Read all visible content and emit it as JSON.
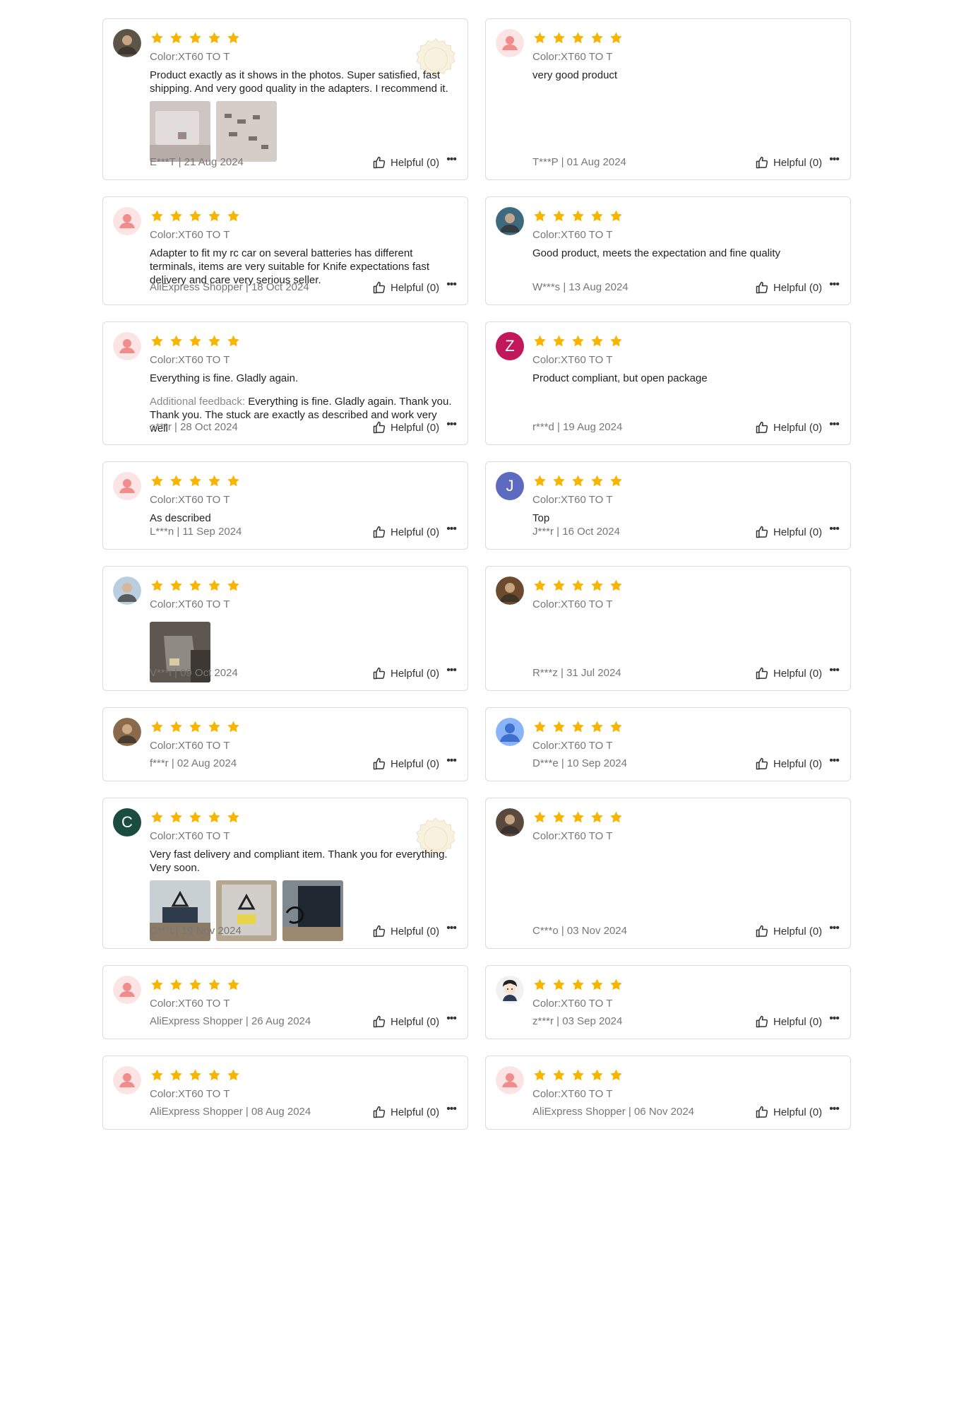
{
  "reviews": [
    {
      "avatar": "photo-avatar",
      "bg": "#5c5447",
      "variant": "Color:XT60 TO T",
      "text": "Product exactly as it shows in the photos. Super satisfied, fast shipping. And very good quality in the adapters. I recommend it.",
      "photos": [
        "photo-1",
        "photo-2"
      ],
      "selected": true,
      "author": "E***T | 21 Aug 2024",
      "helpful": "Helpful (0)"
    },
    {
      "avatar": "default-avatar",
      "variant": "Color:XT60 TO T",
      "text": "very good product",
      "photos": [],
      "author": "T***P | 01 Aug 2024",
      "helpful": "Helpful (0)"
    },
    {
      "avatar": "default-avatar",
      "variant": "Color:XT60 TO T",
      "text": "Adapter to fit my rc car on several batteries has different terminals, items are very suitable for Knife expectations fast delivery and care very serious seller.",
      "photos": [],
      "author": "AliExpress Shopper | 18 Oct 2024",
      "helpful": "Helpful (0)"
    },
    {
      "avatar": "photo-avatar",
      "bg": "#3e6a80",
      "variant": "Color:XT60 TO T",
      "text": "Good product, meets the expectation and fine quality",
      "photos": [],
      "author": "W***s | 13 Aug 2024",
      "helpful": "Helpful (0)"
    },
    {
      "avatar": "default-avatar",
      "variant": "Color:XT60 TO T",
      "text": "Everything is fine. Gladly again.",
      "feedback_label": "Additional feedback:",
      "feedback": "Everything is fine. Gladly again. Thank you. Thank you. The stuck are exactly as described and work very well",
      "photos": [],
      "author": "o***r | 28 Oct 2024",
      "helpful": "Helpful (0)"
    },
    {
      "avatar": "letter-avatar",
      "letter": "Z",
      "bg": "#c2185b",
      "variant": "Color:XT60 TO T",
      "text": "Product compliant, but open package",
      "photos": [],
      "author": "r***d | 19 Aug 2024",
      "helpful": "Helpful (0)"
    },
    {
      "avatar": "default-avatar",
      "variant": "Color:XT60 TO T",
      "text": "As described",
      "photos": [],
      "author": "L***n | 11 Sep 2024",
      "helpful": "Helpful (0)"
    },
    {
      "avatar": "letter-avatar",
      "letter": "J",
      "bg": "#5c6bc0",
      "variant": "Color:XT60 TO T",
      "text": "Top",
      "photos": [],
      "author": "J***r | 16 Oct 2024",
      "helpful": "Helpful (0)"
    },
    {
      "avatar": "photo-avatar",
      "bg": "#b9cfe0",
      "variant": "Color:XT60 TO T",
      "text": "",
      "photos": [
        "photo-3"
      ],
      "author": "V***i | 09 Oct 2024",
      "helpful": "Helpful (0)"
    },
    {
      "avatar": "photo-avatar",
      "bg": "#6b4a2e",
      "variant": "Color:XT60 TO T",
      "text": "",
      "photos": [],
      "author": "R***z | 31 Jul 2024",
      "helpful": "Helpful (0)"
    },
    {
      "avatar": "photo-avatar",
      "bg": "#8a6a4a",
      "variant": "Color:XT60 TO T",
      "text": "",
      "photos": [],
      "author": "f***r | 02 Aug 2024",
      "helpful": "Helpful (0)"
    },
    {
      "avatar": "person-avatar",
      "bg": "#8ab4f8",
      "variant": "Color:XT60 TO T",
      "text": "",
      "photos": [],
      "author": "D***e | 10 Sep 2024",
      "helpful": "Helpful (0)"
    },
    {
      "avatar": "letter-avatar",
      "letter": "C",
      "bg": "#1b4d3e",
      "variant": "Color:XT60 TO T",
      "text": "Very fast delivery and compliant item. Thank you for everything. Very soon.",
      "photos": [
        "photo-4",
        "photo-5",
        "photo-6"
      ],
      "selected": true,
      "author": "C***t | 19 Nov 2024",
      "helpful": "Helpful (0)"
    },
    {
      "avatar": "photo-avatar",
      "bg": "#5a4a3e",
      "variant": "Color:XT60 TO T",
      "text": "",
      "photos": [],
      "author": "C***o | 03 Nov 2024",
      "helpful": "Helpful (0)"
    },
    {
      "avatar": "default-avatar",
      "variant": "Color:XT60 TO T",
      "text": "",
      "photos": [],
      "author": "AliExpress Shopper | 26 Aug 2024",
      "helpful": "Helpful (0)"
    },
    {
      "avatar": "cartoon-avatar",
      "variant": "Color:XT60 TO T",
      "text": "",
      "photos": [],
      "author": "z***r | 03 Sep 2024",
      "helpful": "Helpful (0)"
    },
    {
      "avatar": "default-avatar",
      "variant": "Color:XT60 TO T",
      "text": "",
      "photos": [],
      "author": "AliExpress Shopper | 08 Aug 2024",
      "helpful": "Helpful (0)"
    },
    {
      "avatar": "default-avatar",
      "variant": "Color:XT60 TO T",
      "text": "",
      "photos": [],
      "author": "AliExpress Shopper | 06 Nov 2024",
      "helpful": "Helpful (0)"
    }
  ],
  "colors": {
    "star": "#f7b500",
    "default_avatar_bg": "#fde4e4",
    "default_avatar_fg": "#f08c8c"
  },
  "icons": {
    "rating": "star-icon",
    "helpful": "thumbs-up-icon",
    "more": "more-icon",
    "selected": "selected-badge-icon"
  }
}
